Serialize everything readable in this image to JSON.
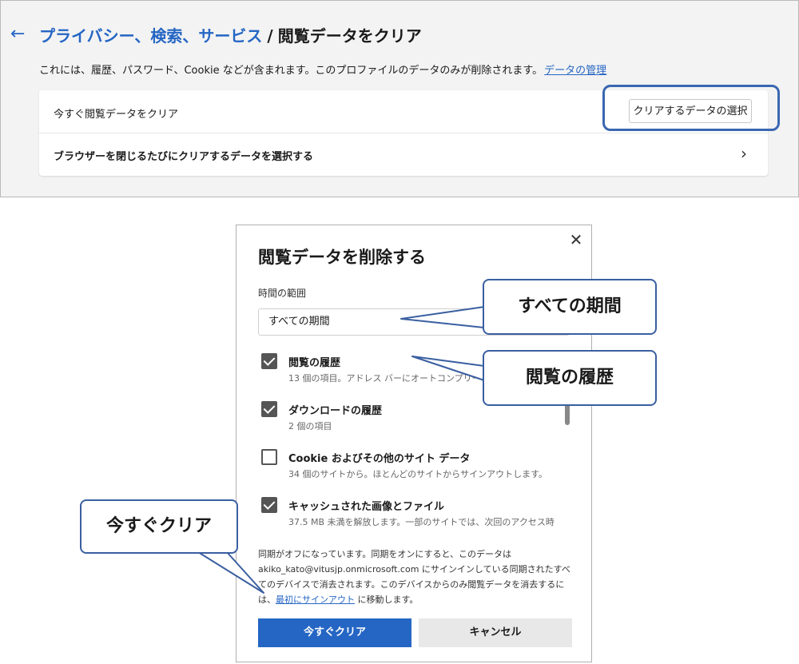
{
  "header": {
    "breadcrumb_link": "プライバシー、検索、サービス",
    "separator": "/",
    "current": "閲覧データをクリア"
  },
  "description": {
    "text": "これには、履歴、パスワード、Cookie などが含まれます。このプロファイルのデータのみが削除されます。",
    "link": "データの管理"
  },
  "card": {
    "row1_label": "今すぐ閲覧データをクリア",
    "row1_button": "クリアするデータの選択",
    "row2_label": "ブラウザーを閉じるたびにクリアするデータを選択する"
  },
  "dialog": {
    "close": "✕",
    "title": "閲覧データを削除する",
    "range_label": "時間の範囲",
    "range_value": "すべての期間",
    "items": [
      {
        "title": "閲覧の履歴",
        "sub": "13 個の項目。アドレス バーにオートコンプリートが",
        "checked": true
      },
      {
        "title": "ダウンロードの履歴",
        "sub": "2 個の項目",
        "checked": true
      },
      {
        "title": "Cookie およびその他のサイト データ",
        "sub": "34 個のサイトから。ほとんどのサイトからサインアウトします。",
        "checked": false
      },
      {
        "title": "キャッシュされた画像とファイル",
        "sub": "37.5 MB 未満を解放します。一部のサイトでは、次回のアクセス時",
        "checked": true
      }
    ],
    "sync_note_1": "同期がオフになっています。同期をオンにすると、このデータは akiko_kato@vitusjp.onmicrosoft.com にサインインしている同期されたすべてのデバイスで消去されます。このデバイスからのみ閲覧データを消去するには、",
    "sync_link": "最初にサインアウト",
    "sync_note_2": " に移動します。",
    "clear_button": "今すぐクリア",
    "cancel_button": "キャンセル"
  },
  "callouts": {
    "range": "すべての期間",
    "history": "閲覧の履歴",
    "clear_now": "今すぐクリア"
  },
  "colors": {
    "accent": "#2566c4",
    "callout_border": "#3a5fa0"
  }
}
